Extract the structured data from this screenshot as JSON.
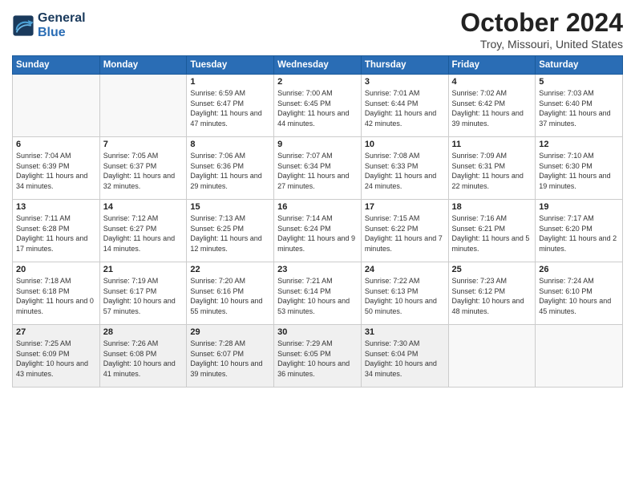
{
  "header": {
    "logo_line1": "General",
    "logo_line2": "Blue",
    "month": "October 2024",
    "location": "Troy, Missouri, United States"
  },
  "weekdays": [
    "Sunday",
    "Monday",
    "Tuesday",
    "Wednesday",
    "Thursday",
    "Friday",
    "Saturday"
  ],
  "weeks": [
    [
      {
        "day": "",
        "info": ""
      },
      {
        "day": "",
        "info": ""
      },
      {
        "day": "1",
        "info": "Sunrise: 6:59 AM\nSunset: 6:47 PM\nDaylight: 11 hours and 47 minutes."
      },
      {
        "day": "2",
        "info": "Sunrise: 7:00 AM\nSunset: 6:45 PM\nDaylight: 11 hours and 44 minutes."
      },
      {
        "day": "3",
        "info": "Sunrise: 7:01 AM\nSunset: 6:44 PM\nDaylight: 11 hours and 42 minutes."
      },
      {
        "day": "4",
        "info": "Sunrise: 7:02 AM\nSunset: 6:42 PM\nDaylight: 11 hours and 39 minutes."
      },
      {
        "day": "5",
        "info": "Sunrise: 7:03 AM\nSunset: 6:40 PM\nDaylight: 11 hours and 37 minutes."
      }
    ],
    [
      {
        "day": "6",
        "info": "Sunrise: 7:04 AM\nSunset: 6:39 PM\nDaylight: 11 hours and 34 minutes."
      },
      {
        "day": "7",
        "info": "Sunrise: 7:05 AM\nSunset: 6:37 PM\nDaylight: 11 hours and 32 minutes."
      },
      {
        "day": "8",
        "info": "Sunrise: 7:06 AM\nSunset: 6:36 PM\nDaylight: 11 hours and 29 minutes."
      },
      {
        "day": "9",
        "info": "Sunrise: 7:07 AM\nSunset: 6:34 PM\nDaylight: 11 hours and 27 minutes."
      },
      {
        "day": "10",
        "info": "Sunrise: 7:08 AM\nSunset: 6:33 PM\nDaylight: 11 hours and 24 minutes."
      },
      {
        "day": "11",
        "info": "Sunrise: 7:09 AM\nSunset: 6:31 PM\nDaylight: 11 hours and 22 minutes."
      },
      {
        "day": "12",
        "info": "Sunrise: 7:10 AM\nSunset: 6:30 PM\nDaylight: 11 hours and 19 minutes."
      }
    ],
    [
      {
        "day": "13",
        "info": "Sunrise: 7:11 AM\nSunset: 6:28 PM\nDaylight: 11 hours and 17 minutes."
      },
      {
        "day": "14",
        "info": "Sunrise: 7:12 AM\nSunset: 6:27 PM\nDaylight: 11 hours and 14 minutes."
      },
      {
        "day": "15",
        "info": "Sunrise: 7:13 AM\nSunset: 6:25 PM\nDaylight: 11 hours and 12 minutes."
      },
      {
        "day": "16",
        "info": "Sunrise: 7:14 AM\nSunset: 6:24 PM\nDaylight: 11 hours and 9 minutes."
      },
      {
        "day": "17",
        "info": "Sunrise: 7:15 AM\nSunset: 6:22 PM\nDaylight: 11 hours and 7 minutes."
      },
      {
        "day": "18",
        "info": "Sunrise: 7:16 AM\nSunset: 6:21 PM\nDaylight: 11 hours and 5 minutes."
      },
      {
        "day": "19",
        "info": "Sunrise: 7:17 AM\nSunset: 6:20 PM\nDaylight: 11 hours and 2 minutes."
      }
    ],
    [
      {
        "day": "20",
        "info": "Sunrise: 7:18 AM\nSunset: 6:18 PM\nDaylight: 11 hours and 0 minutes."
      },
      {
        "day": "21",
        "info": "Sunrise: 7:19 AM\nSunset: 6:17 PM\nDaylight: 10 hours and 57 minutes."
      },
      {
        "day": "22",
        "info": "Sunrise: 7:20 AM\nSunset: 6:16 PM\nDaylight: 10 hours and 55 minutes."
      },
      {
        "day": "23",
        "info": "Sunrise: 7:21 AM\nSunset: 6:14 PM\nDaylight: 10 hours and 53 minutes."
      },
      {
        "day": "24",
        "info": "Sunrise: 7:22 AM\nSunset: 6:13 PM\nDaylight: 10 hours and 50 minutes."
      },
      {
        "day": "25",
        "info": "Sunrise: 7:23 AM\nSunset: 6:12 PM\nDaylight: 10 hours and 48 minutes."
      },
      {
        "day": "26",
        "info": "Sunrise: 7:24 AM\nSunset: 6:10 PM\nDaylight: 10 hours and 45 minutes."
      }
    ],
    [
      {
        "day": "27",
        "info": "Sunrise: 7:25 AM\nSunset: 6:09 PM\nDaylight: 10 hours and 43 minutes."
      },
      {
        "day": "28",
        "info": "Sunrise: 7:26 AM\nSunset: 6:08 PM\nDaylight: 10 hours and 41 minutes."
      },
      {
        "day": "29",
        "info": "Sunrise: 7:28 AM\nSunset: 6:07 PM\nDaylight: 10 hours and 39 minutes."
      },
      {
        "day": "30",
        "info": "Sunrise: 7:29 AM\nSunset: 6:05 PM\nDaylight: 10 hours and 36 minutes."
      },
      {
        "day": "31",
        "info": "Sunrise: 7:30 AM\nSunset: 6:04 PM\nDaylight: 10 hours and 34 minutes."
      },
      {
        "day": "",
        "info": ""
      },
      {
        "day": "",
        "info": ""
      }
    ]
  ]
}
